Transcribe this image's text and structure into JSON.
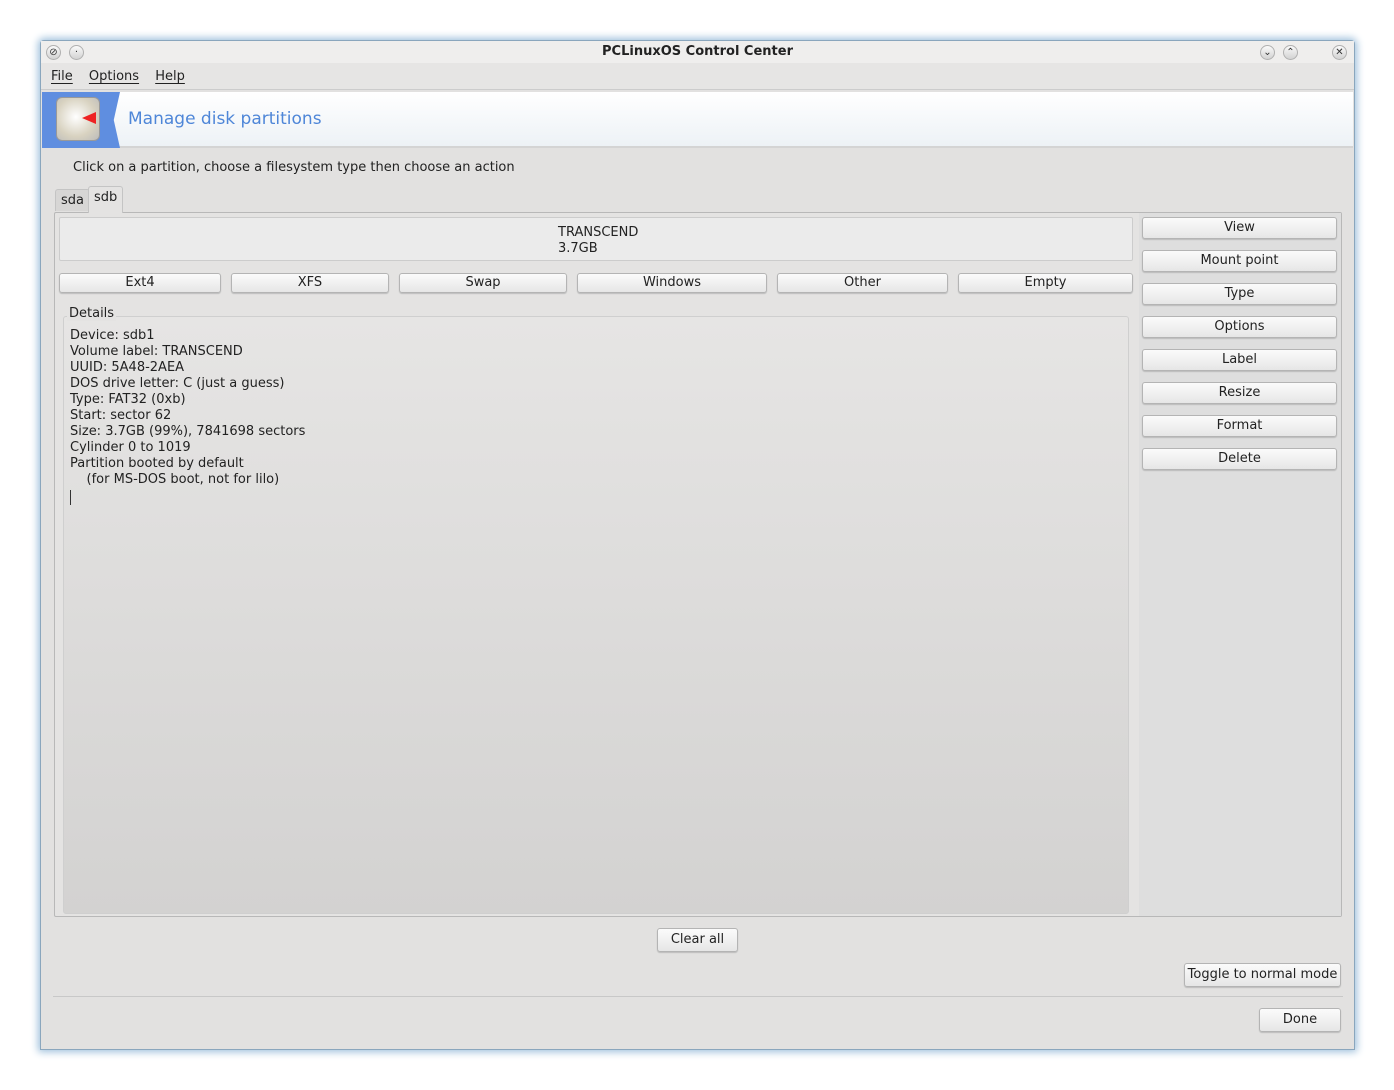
{
  "window": {
    "title": "PCLinuxOS Control Center"
  },
  "menu": [
    "File",
    "Options",
    "Help"
  ],
  "banner": {
    "title": "Manage disk partitions"
  },
  "hint": "Click on a partition, choose a filesystem type then choose an action",
  "tabs": [
    "sda",
    "sdb"
  ],
  "disk": {
    "label": "TRANSCEND",
    "size": "3.7GB"
  },
  "fs_buttons": [
    "Ext4",
    "XFS",
    "Swap",
    "Windows",
    "Other",
    "Empty"
  ],
  "details": {
    "legend": "Details",
    "lines": "Device: sdb1\nVolume label: TRANSCEND\nUUID: 5A48-2AEA\nDOS drive letter: C (just a guess)\nType: FAT32 (0xb)\nStart: sector 62\nSize: 3.7GB (99%), 7841698 sectors\nCylinder 0 to 1019\nPartition booted by default\n    (for MS-DOS boot, not for lilo)"
  },
  "actions": [
    "View",
    "Mount point",
    "Type",
    "Options",
    "Label",
    "Resize",
    "Format",
    "Delete"
  ],
  "bottom": {
    "clear_all": "Clear all",
    "toggle": "Toggle to normal mode",
    "done": "Done"
  }
}
